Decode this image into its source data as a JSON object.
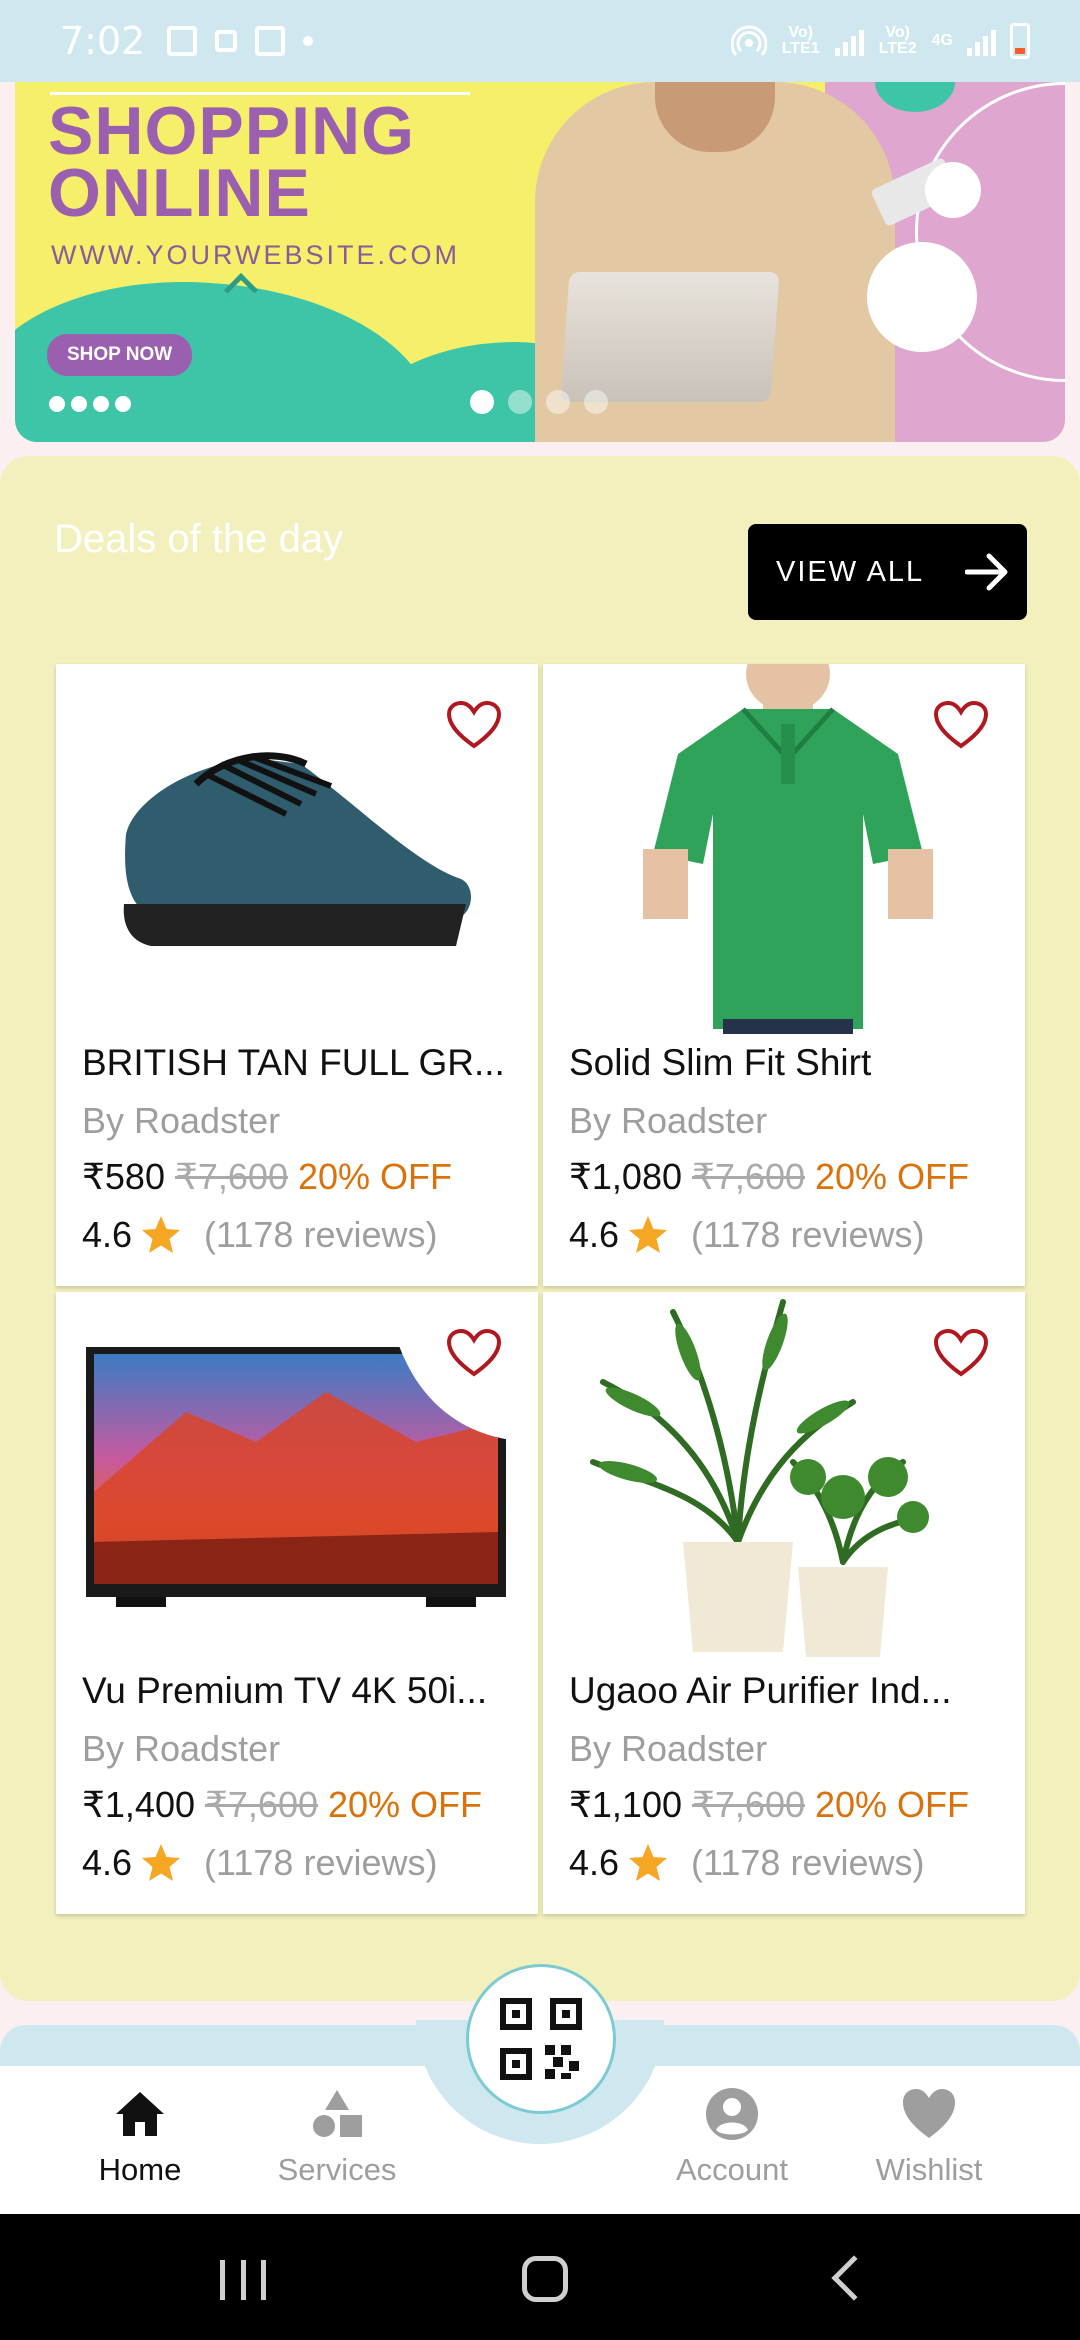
{
  "status_bar": {
    "time": "7:02",
    "lte1": "Vo) LTE1",
    "lte2": "Vo) LTE2",
    "network": "4G",
    "battery_color": "#ff5a2a"
  },
  "banner": {
    "headline_line1": "SHOPPING",
    "headline_line2": "ONLINE",
    "url": "WWW.YOURWEBSITE.COM",
    "cta": "SHOP NOW",
    "slide_count": 4,
    "active_slide": 1
  },
  "deals": {
    "title": "Deals of the day",
    "view_all": "VIEW ALL",
    "products": [
      {
        "name": "BRITISH TAN FULL GR...",
        "brand": "By Roadster",
        "price": "₹580",
        "old_price": "₹7,600",
        "discount": "20% OFF",
        "rating": "4.6",
        "reviews": "(1178 reviews)",
        "image_icon": "sneaker-image"
      },
      {
        "name": "Solid Slim Fit Shirt",
        "brand": "By Roadster",
        "price": "₹1,080",
        "old_price": "₹7,600",
        "discount": "20% OFF",
        "rating": "4.6",
        "reviews": "(1178 reviews)",
        "image_icon": "polo-shirt-image"
      },
      {
        "name": "Vu Premium TV 4K 50i...",
        "brand": "By Roadster",
        "price": "₹1,400",
        "old_price": "₹7,600",
        "discount": "20% OFF",
        "rating": "4.6",
        "reviews": "(1178 reviews)",
        "image_icon": "television-image"
      },
      {
        "name": "Ugaoo Air Purifier Ind...",
        "brand": "By Roadster",
        "price": "₹1,100",
        "old_price": "₹7,600",
        "discount": "20% OFF",
        "rating": "4.6",
        "reviews": "(1178 reviews)",
        "image_icon": "plant-image"
      }
    ]
  },
  "bottom_nav": {
    "home": "Home",
    "services": "Services",
    "account": "Account",
    "wishlist": "Wishlist",
    "scan_icon": "qr-code-icon"
  },
  "colors": {
    "accent_orange": "#d9720a",
    "heart_red": "#b0171f",
    "star": "#f5a623",
    "deals_bg": "#f2f0bc",
    "nav_accent": "#cfe8f0"
  }
}
